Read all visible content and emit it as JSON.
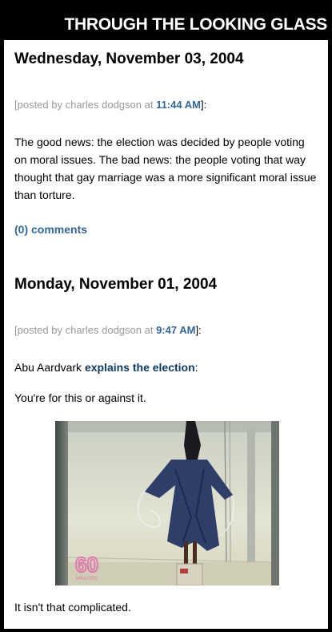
{
  "site": {
    "title": "THROUGH THE LOOKING GLASS"
  },
  "posts": [
    {
      "date": "Wednesday, November 03, 2004",
      "byline_prefix": "[posted by charles dodgson at ",
      "time": "11:44 AM",
      "byline_suffix": "]:",
      "body": "The good news: the election was decided by people voting on moral issues. The bad news: the people voting that way thought that gay marriage was a more significant moral issue than torture.",
      "comments_label": "(0) comments"
    },
    {
      "date": "Monday, November 01, 2004",
      "byline_prefix": "[posted by charles dodgson at ",
      "time": "9:47 AM",
      "byline_suffix": "]:",
      "intro_prefix": "Abu Aardvark ",
      "intro_link": "explains the election",
      "intro_suffix": ":",
      "line2": "You're for this or against it.",
      "photo_logo": "60",
      "photo_logo_sub": "MINUTES",
      "line3": "It isn't that complicated."
    }
  ],
  "colors": {
    "link": "#336699",
    "byline": "#999999",
    "background": "#000000"
  }
}
